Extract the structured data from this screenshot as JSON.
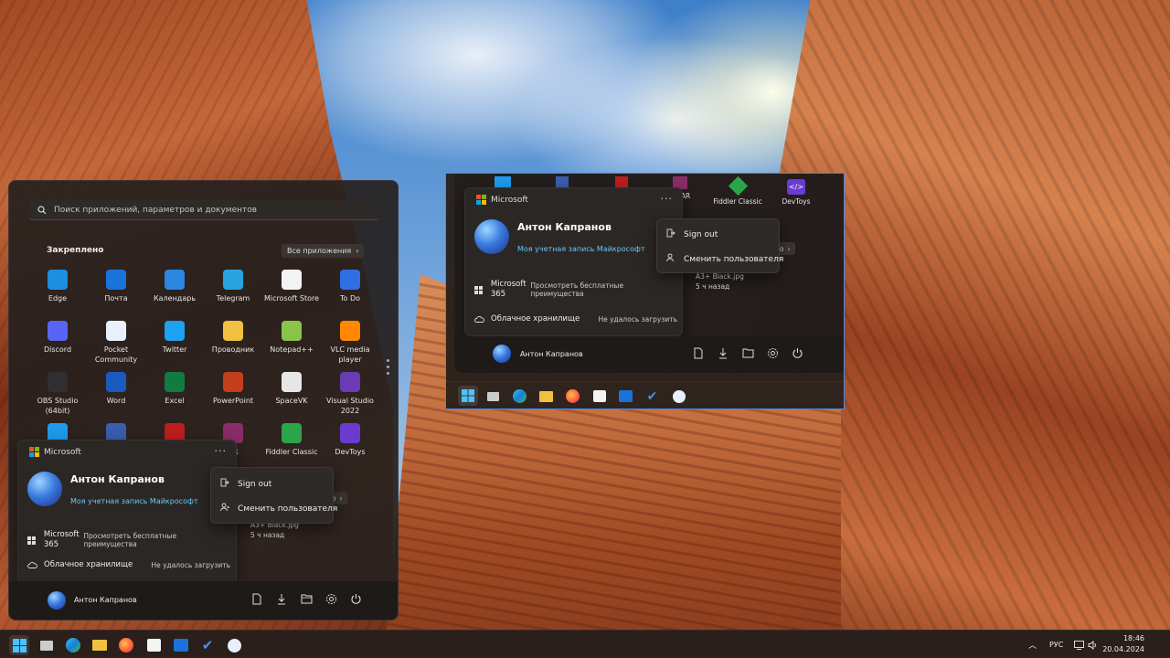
{
  "search": {
    "placeholder": "Поиск приложений, параметров и документов"
  },
  "pinned": {
    "title": "Закреплено",
    "all_apps_label": "Все приложения",
    "apps": [
      {
        "label": "Edge",
        "icon": "edge-icon",
        "color": "#1d8ee0"
      },
      {
        "label": "Почта",
        "icon": "mail-icon",
        "color": "#1a73d9"
      },
      {
        "label": "Календарь",
        "icon": "calendar-icon",
        "color": "#2a86e0"
      },
      {
        "label": "Telegram",
        "icon": "telegram-icon",
        "color": "#2aa3e0"
      },
      {
        "label": "Microsoft Store",
        "icon": "store-icon",
        "color": "#f3f3f3"
      },
      {
        "label": "To Do",
        "icon": "todo-icon",
        "color": "#2f6fe4"
      },
      {
        "label": "Discord",
        "icon": "discord-icon",
        "color": "#5865f2"
      },
      {
        "label": "Pocket Community",
        "icon": "pocket-icon",
        "color": "#e9f0fb"
      },
      {
        "label": "Twitter",
        "icon": "twitter-icon",
        "color": "#1da1f2"
      },
      {
        "label": "Проводник",
        "icon": "folder-icon",
        "color": "#f0c040"
      },
      {
        "label": "Notepad++",
        "icon": "notepad-icon",
        "color": "#8ac34a"
      },
      {
        "label": "VLC media player",
        "icon": "vlc-icon",
        "color": "#ff8800"
      },
      {
        "label": "OBS Studio (64bit)",
        "icon": "obs-icon",
        "color": "#302e31"
      },
      {
        "label": "Word",
        "icon": "word-icon",
        "color": "#185abd"
      },
      {
        "label": "Excel",
        "icon": "excel-icon",
        "color": "#107c41"
      },
      {
        "label": "PowerPoint",
        "icon": "powerpoint-icon",
        "color": "#c43e1c"
      },
      {
        "label": "SpaceVK",
        "icon": "spacevk-icon",
        "color": "#e6e6e6"
      },
      {
        "label": "Visual Studio 2022",
        "icon": "visual-studio-icon",
        "color": "#6a3bb5"
      },
      {
        "label": "",
        "icon": "vscode-icon",
        "color": "#1f9cf0"
      },
      {
        "label": "",
        "icon": "monitor-icon",
        "color": "#3a5fb0"
      },
      {
        "label": "",
        "icon": "filezilla-icon",
        "color": "#bf1e1e"
      },
      {
        "label": "AR",
        "icon": "winrar-icon",
        "color": "#8a2d6a"
      },
      {
        "label": "Fiddler Classic",
        "icon": "fiddler-icon",
        "color": "#2aa54a"
      },
      {
        "label": "DevToys",
        "icon": "devtoys-icon",
        "color": "#6b3bd1"
      }
    ]
  },
  "account": {
    "brand": "Microsoft",
    "more": "···",
    "name": "Антон Капранов",
    "link": "Моя учетная запись Майкрософт",
    "m365_label": "Microsoft 365",
    "m365_value": "Просмотреть бесплатные преимущества",
    "cloud_label": "Облачное хранилище",
    "cloud_value": "Не удалось загрузить"
  },
  "context_menu": {
    "sign_out": "Sign out",
    "switch_user": "Сменить пользователя"
  },
  "behind": {
    "btn_fragment": "но",
    "file_name": "A3+ Black.jpg",
    "file_time": "5 ч назад"
  },
  "footer": {
    "user_name": "Антон Капранов"
  },
  "taskbar": {
    "lang": "РУС",
    "time": "18:46",
    "date": "20.04.2024"
  },
  "colors": {
    "accent": "#4a88e8",
    "link": "#6cc6f2",
    "menu_bg": "#26201e"
  }
}
